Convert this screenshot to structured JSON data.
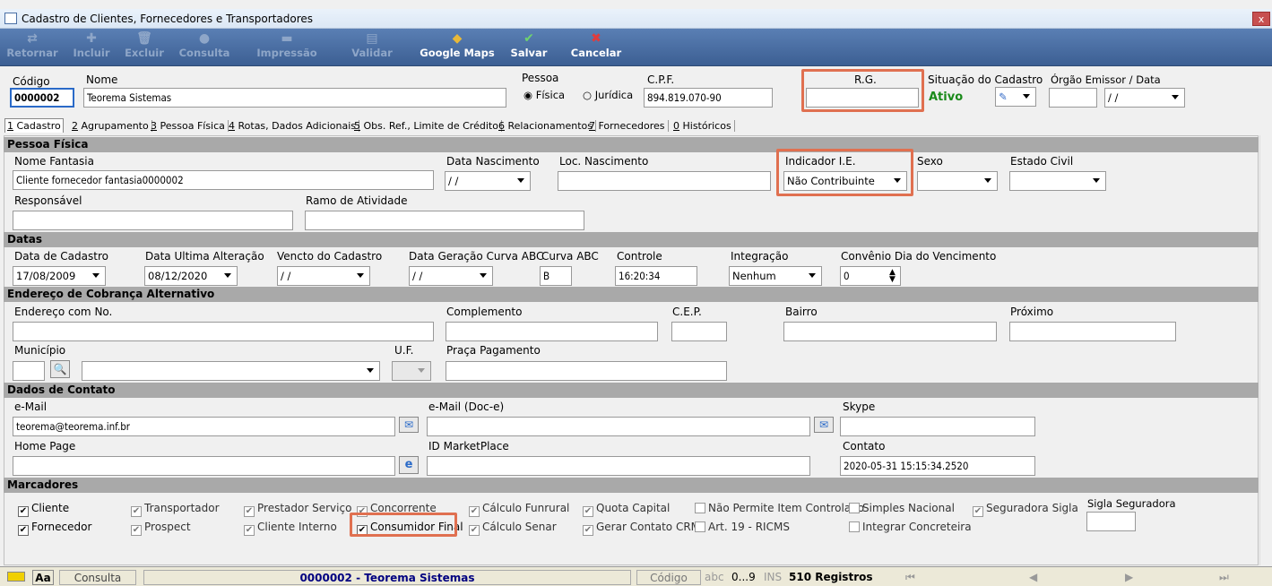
{
  "window": {
    "title": "Cadastro de Clientes, Fornecedores e Transportadores",
    "close": "x"
  },
  "toolbar": [
    {
      "label": "Retornar",
      "icon": "return-icon",
      "enabled": false
    },
    {
      "label": "Incluir",
      "icon": "plus-icon",
      "enabled": false
    },
    {
      "label": "Excluir",
      "icon": "trash-icon",
      "enabled": false
    },
    {
      "label": "Consulta",
      "icon": "search-icon",
      "enabled": false
    },
    {
      "label": "Impressão",
      "icon": "printer-icon",
      "enabled": false
    },
    {
      "label": "Validar",
      "icon": "validate-icon",
      "enabled": false
    },
    {
      "label": "Google Maps",
      "icon": "map-pin-icon",
      "enabled": true
    },
    {
      "label": "Salvar",
      "icon": "check-icon",
      "enabled": true
    },
    {
      "label": "Cancelar",
      "icon": "x-icon",
      "enabled": true
    }
  ],
  "header": {
    "codigo_label": "Código",
    "codigo": "0000002",
    "nome_label": "Nome",
    "nome": "Teorema Sistemas",
    "pessoa_label": "Pessoa",
    "fisica": "Física",
    "juridica": "Jurídica",
    "cpf_label": "C.P.F.",
    "cpf": "894.819.070-90",
    "rg_label": "R.G.",
    "rg": "",
    "situacao_label": "Situação do Cadastro",
    "situacao": "Ativo",
    "orgao_label": "Órgão Emissor  / Data",
    "orgao_data": "/ /"
  },
  "tabs": [
    {
      "key": "1",
      "label": "Cadastro"
    },
    {
      "key": "2",
      "label": "Agrupamento"
    },
    {
      "key": "3",
      "label": "Pessoa Física"
    },
    {
      "key": "4",
      "label": "Rotas, Dados Adicionais"
    },
    {
      "key": "5",
      "label": "Obs. Ref., Limite de Crédito"
    },
    {
      "key": "6",
      "label": "Relacionamentos"
    },
    {
      "key": "7",
      "label": "Fornecedores"
    },
    {
      "key": "0",
      "label": "Históricos"
    }
  ],
  "pessoa_fisica": {
    "section": "Pessoa Física",
    "nome_fantasia_label": "Nome Fantasia",
    "nome_fantasia": "Cliente fornecedor fantasia0000002",
    "data_nasc_label": "Data Nascimento",
    "data_nasc": "/ /",
    "loc_nasc_label": "Loc. Nascimento",
    "indicador_label": "Indicador I.E.",
    "indicador": "Não Contribuinte",
    "sexo_label": "Sexo",
    "estado_civil_label": "Estado Civil",
    "responsavel_label": "Responsável",
    "ramo_label": "Ramo de Atividade"
  },
  "datas": {
    "section": "Datas",
    "cadastro_label": "Data de Cadastro",
    "cadastro": "17/08/2009",
    "ultima_label": "Data Ultima Alteração",
    "ultima": "08/12/2020",
    "vencto_label": "Vencto do Cadastro",
    "vencto": "/ /",
    "curva_data_label": "Data Geração Curva ABC",
    "curva_data": "/ /",
    "curva_label": "Curva ABC",
    "curva": "B",
    "controle_label": "Controle",
    "controle": "16:20:34",
    "integracao_label": "Integração",
    "integracao": "Nenhum",
    "convenio_label": "Convênio Dia do Vencimento",
    "convenio": "0"
  },
  "endereco": {
    "section": "Endereço de Cobrança Alternativo",
    "endereco_label": "Endereço com No.",
    "complemento_label": "Complemento",
    "cep_label": "C.E.P.",
    "bairro_label": "Bairro",
    "proximo_label": "Próximo",
    "municipio_label": "Município",
    "uf_label": "U.F.",
    "praca_label": "Praça Pagamento"
  },
  "contato": {
    "section": "Dados de Contato",
    "email_label": "e-Mail",
    "email": "teorema@teorema.inf.br",
    "email_doc_label": "e-Mail (Doc-e)",
    "skype_label": "Skype",
    "homepage_label": "Home Page",
    "marketplace_label": "ID MarketPlace",
    "contato_label": "Contato",
    "contato": "2020-05-31 15:15:34.2520"
  },
  "marcadores": {
    "section": "Marcadores",
    "items": [
      {
        "label": "Cliente",
        "checked": true,
        "enabled": true
      },
      {
        "label": "Fornecedor",
        "checked": true,
        "enabled": true
      },
      {
        "label": "Transportador",
        "checked": true,
        "enabled": false
      },
      {
        "label": "Prospect",
        "checked": true,
        "enabled": false
      },
      {
        "label": "Prestador Serviço",
        "checked": true,
        "enabled": false
      },
      {
        "label": "Cliente Interno",
        "checked": true,
        "enabled": false
      },
      {
        "label": "Concorrente",
        "checked": true,
        "enabled": false
      },
      {
        "label": "Consumidor Final",
        "checked": true,
        "enabled": true
      },
      {
        "label": "Cálculo Funrural",
        "checked": true,
        "enabled": false
      },
      {
        "label": "Cálculo Senar",
        "checked": true,
        "enabled": false
      },
      {
        "label": "Quota Capital",
        "checked": true,
        "enabled": false
      },
      {
        "label": "Gerar Contato CRM",
        "checked": true,
        "enabled": false
      },
      {
        "label": "Não Permite Item Controlado",
        "checked": false,
        "enabled": false
      },
      {
        "label": "Art. 19 - RICMS",
        "checked": false,
        "enabled": false
      },
      {
        "label": "Simples Nacional",
        "checked": false,
        "enabled": false
      },
      {
        "label": "Integrar Concreteira",
        "checked": false,
        "enabled": false
      },
      {
        "label": "Seguradora Sigla",
        "checked": true,
        "enabled": false
      }
    ],
    "sigla_label": "Sigla Seguradora"
  },
  "status": {
    "aa": "Aa",
    "mode": "Consulta",
    "record": "0000002 - Teorema Sistemas",
    "field": "Código",
    "abc": "abc",
    "num": "0...9",
    "ins": "INS",
    "count": "510 Registros"
  },
  "colors": {
    "highlight": "#e07050",
    "active": "#1a8a1a",
    "record": "#000080"
  }
}
